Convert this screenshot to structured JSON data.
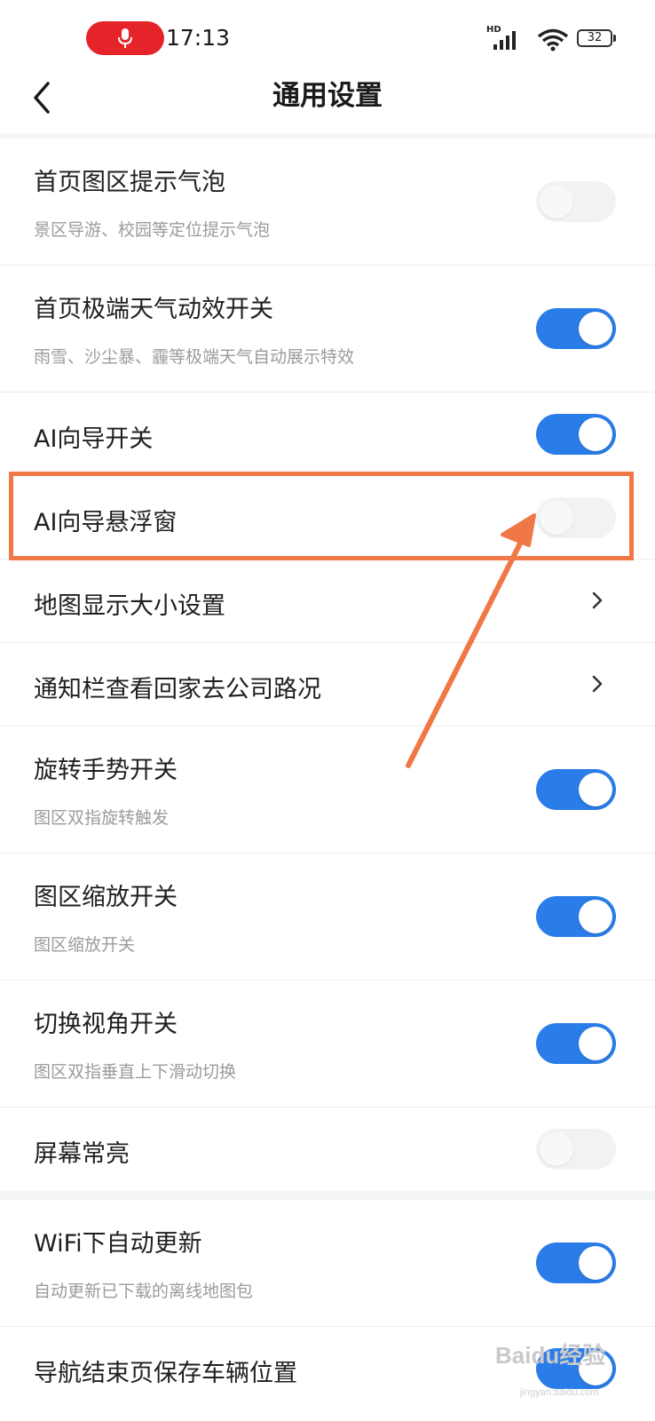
{
  "status_bar": {
    "time": "17:13",
    "network": "HD",
    "battery": "32",
    "icons": [
      "microphone-icon",
      "signal-icon",
      "wifi-icon",
      "battery-icon"
    ]
  },
  "nav": {
    "title": "通用设置",
    "back_icon": "chevron-left-icon"
  },
  "settings": [
    {
      "title": "首页图区提示气泡",
      "subtitle": "景区导游、校园等定位提示气泡",
      "toggle": "off"
    },
    {
      "title": "首页极端天气动效开关",
      "subtitle": "雨雪、沙尘暴、霾等极端天气自动展示特效",
      "toggle": "on"
    },
    {
      "title": "AI向导开关",
      "toggle": "on"
    },
    {
      "title": "AI向导悬浮窗",
      "toggle": "off",
      "highlighted": true
    },
    {
      "title": "地图显示大小设置",
      "control": "chevron"
    },
    {
      "title": "通知栏查看回家去公司路况",
      "control": "chevron"
    },
    {
      "title": "旋转手势开关",
      "subtitle": "图区双指旋转触发",
      "toggle": "on"
    },
    {
      "title": "图区缩放开关",
      "subtitle": "图区缩放开关",
      "toggle": "on"
    },
    {
      "title": "切换视角开关",
      "subtitle": "图区双指垂直上下滑动切换",
      "toggle": "on"
    },
    {
      "title": "屏幕常亮",
      "toggle": "off"
    },
    {
      "title": "WiFi下自动更新",
      "subtitle": "自动更新已下载的离线地图包",
      "toggle": "on"
    },
    {
      "title": "导航结束页保存车辆位置",
      "toggle": "on"
    }
  ],
  "annotation": {
    "color": "#f07846"
  },
  "colors": {
    "toggle_on": "#2a7de8",
    "toggle_off": "#f1f2f4",
    "accent_red": "#e5242a"
  },
  "watermark": {
    "brand": "Bai",
    "brand2": "du",
    "cn": "经验",
    "url": "jingyan.baidu.com"
  }
}
